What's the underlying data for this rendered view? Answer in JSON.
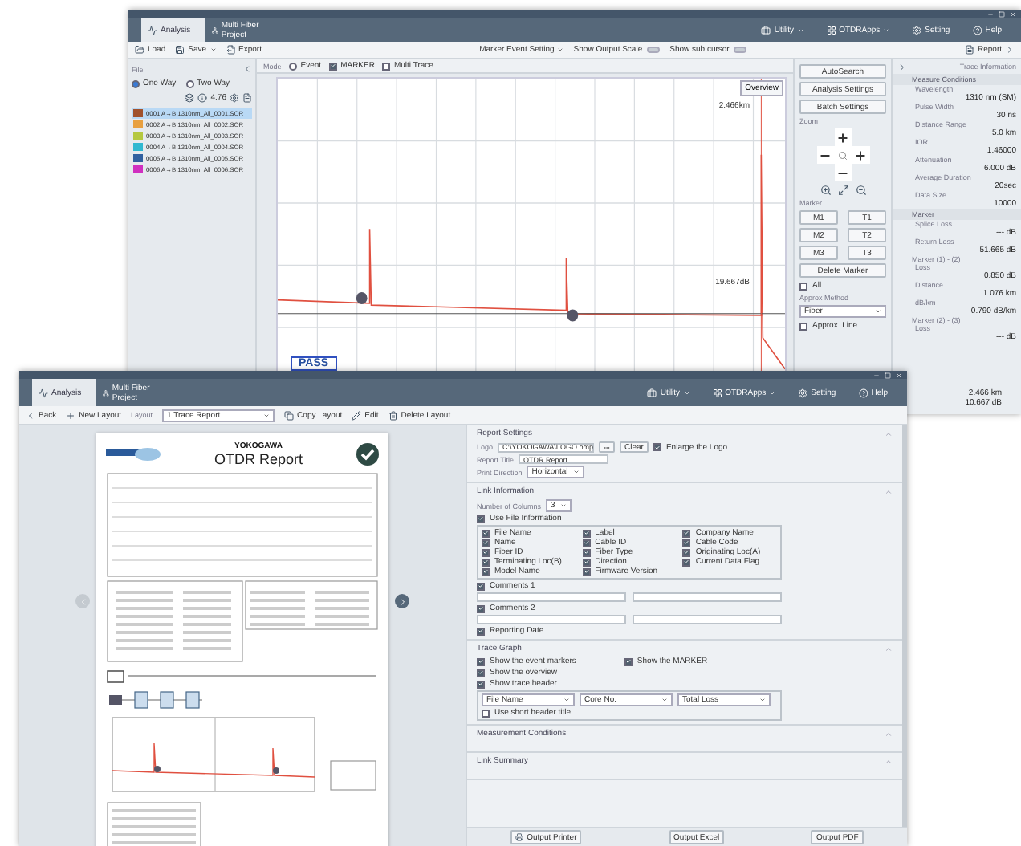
{
  "back_window": {
    "tabs": [
      {
        "label": "Analysis",
        "selected": true
      },
      {
        "label": "Multi Fiber Project",
        "selected": false
      }
    ],
    "menu": [
      "Utility",
      "OTDRApps",
      "Setting",
      "Help"
    ],
    "toolbar": {
      "load": "Load",
      "save": "Save",
      "export": "Export",
      "marker_event": "Marker Event Setting",
      "toggles": [
        {
          "label": "Show Output Scale",
          "on": false
        },
        {
          "label": "Show sub cursor",
          "on": false
        }
      ],
      "report": "Report"
    },
    "file_panel": {
      "title": "File",
      "direction": [
        {
          "label": "One Way",
          "selected": true
        },
        {
          "label": "Two Way",
          "selected": false
        }
      ],
      "zoom_reading": "4.76",
      "files": [
        {
          "label": "0001  A→B  1310nm_All_0001.SOR",
          "color": "#a0522d",
          "selected": true
        },
        {
          "label": "0002  A→B  1310nm_All_0002.SOR",
          "color": "#e8a040",
          "selected": false
        },
        {
          "label": "0003  A→B  1310nm_All_0003.SOR",
          "color": "#b5c840",
          "selected": false
        },
        {
          "label": "0004  A→B  1310nm_All_0004.SOR",
          "color": "#30b8d0",
          "selected": false
        },
        {
          "label": "0005  A→B  1310nm_All_0005.SOR",
          "color": "#3060a0",
          "selected": false
        },
        {
          "label": "0006  A→B  1310nm_All_0006.SOR",
          "color": "#d030c0",
          "selected": false
        }
      ]
    },
    "view": {
      "mode_label": "Mode",
      "options": [
        {
          "kind": "radio",
          "label": "Event",
          "checked": false
        },
        {
          "kind": "check",
          "label": "MARKER",
          "checked": true
        },
        {
          "kind": "check",
          "label": "Multi Trace",
          "checked": false
        }
      ]
    },
    "chart": {
      "overview": "Overview",
      "distance": "2.466km",
      "loss": "19.667dB",
      "verdict": "PASS"
    },
    "actions": [
      "AutoSearch",
      "Analysis Settings",
      "Batch Settings"
    ],
    "zoom_label": "Zoom",
    "marker_label": "Marker",
    "marker_buttons": [
      "M1",
      "T1",
      "M2",
      "T2",
      "M3",
      "T3"
    ],
    "delete_marker": "Delete Marker",
    "all": {
      "label": "All",
      "checked": false
    },
    "approx": {
      "label": "Approx Method",
      "value": "Fiber",
      "line": {
        "label": "Approx. Line",
        "checked": false
      }
    },
    "info": {
      "title": "Trace Information",
      "sections": [
        {
          "title": "Measure Conditions",
          "rows": [
            {
              "label": "Wavelength",
              "value": "1310 nm (SM)"
            },
            {
              "label": "Pulse Width",
              "value": "30 ns"
            },
            {
              "label": "Distance Range",
              "value": "5.0 km"
            },
            {
              "label": "IOR",
              "value": "1.46000"
            },
            {
              "label": "Attenuation",
              "value": "6.000 dB"
            },
            {
              "label": "Average Duration",
              "value": "20sec"
            },
            {
              "label": "Data Size",
              "value": "10000"
            }
          ]
        },
        {
          "title": "Marker",
          "rows": [
            {
              "label": "Splice Loss",
              "value": "--- dB"
            },
            {
              "label": "Return Loss",
              "value": "51.665 dB"
            },
            {
              "label": "Marker (1) - (2)",
              "sub": true
            },
            {
              "label": "Loss",
              "value": "0.850 dB"
            },
            {
              "label": "Distance",
              "value": "1.076 km"
            },
            {
              "label": "dB/km",
              "value": "0.790 dB/km"
            },
            {
              "label": "Marker (2) - (3)",
              "sub": true
            },
            {
              "label": "Loss",
              "value": "--- dB"
            }
          ]
        }
      ],
      "tail": [
        "2.466 km",
        "10.667 dB"
      ]
    }
  },
  "front_window": {
    "tabs": [
      {
        "label": "Analysis",
        "selected": true
      },
      {
        "label": "Multi Fiber Project",
        "selected": false
      }
    ],
    "menu": [
      "Utility",
      "OTDRApps",
      "Setting",
      "Help"
    ],
    "toolbar": {
      "back": "Back",
      "new_layout": "New Layout",
      "layout_label": "Layout",
      "layout": "1 Trace Report",
      "copy": "Copy Layout",
      "edit": "Edit",
      "delete": "Delete Layout"
    },
    "report": {
      "brand": "YOKOGAWA",
      "title": "OTDR Report"
    },
    "settings": [
      {
        "kind": "report",
        "title": "Report Settings",
        "logo_label": "Logo",
        "logo_path": "C:\\YOKOGAWA\\LOGO.bmp",
        "clear": "Clear",
        "enlarge": {
          "label": "Enlarge the Logo",
          "checked": true
        },
        "title_label": "Report Title",
        "title_value": "OTDR Report",
        "direction_label": "Print Direction",
        "direction_value": "Horizontal"
      },
      {
        "kind": "link",
        "title": "Link Information",
        "columns_label": "Number of Columns",
        "columns_value": "3",
        "use_file": {
          "label": "Use File Information",
          "checked": true
        },
        "fields": [
          {
            "label": "File Name",
            "checked": true
          },
          {
            "label": "Label",
            "checked": true
          },
          {
            "label": "Company Name",
            "checked": true
          },
          {
            "label": "Name",
            "checked": true
          },
          {
            "label": "Cable ID",
            "checked": true
          },
          {
            "label": "Cable Code",
            "checked": true
          },
          {
            "label": "Fiber ID",
            "checked": true
          },
          {
            "label": "Fiber Type",
            "checked": true
          },
          {
            "label": "Originating Loc(A)",
            "checked": true
          },
          {
            "label": "Terminating Loc(B)",
            "checked": true
          },
          {
            "label": "Direction",
            "checked": true
          },
          {
            "label": "Current Data Flag",
            "checked": true
          },
          {
            "label": "Model Name",
            "checked": true
          },
          {
            "label": "Firmware Version",
            "checked": true
          }
        ],
        "comments": [
          {
            "label": "Comments 1",
            "checked": true
          },
          {
            "label": "Comments 2",
            "checked": true
          }
        ],
        "reporting_date": {
          "label": "Reporting Date",
          "checked": true
        }
      },
      {
        "kind": "trace",
        "title": "Trace Graph",
        "options": [
          {
            "label": "Show the event markers",
            "checked": true
          },
          {
            "label": "Show the MARKER",
            "checked": true
          },
          {
            "label": "Show the overview",
            "checked": true
          }
        ],
        "header": {
          "label": "Show trace header",
          "checked": true
        },
        "header_fields": [
          "File Name",
          "Core No.",
          "Total Loss"
        ],
        "short": {
          "label": "Use short header title",
          "checked": false
        }
      },
      {
        "kind": "plain",
        "title": "Measurement Conditions"
      },
      {
        "kind": "plain",
        "title": "Link Summary"
      }
    ],
    "outputs": [
      "Output Printer",
      "Output Excel",
      "Output PDF"
    ]
  }
}
